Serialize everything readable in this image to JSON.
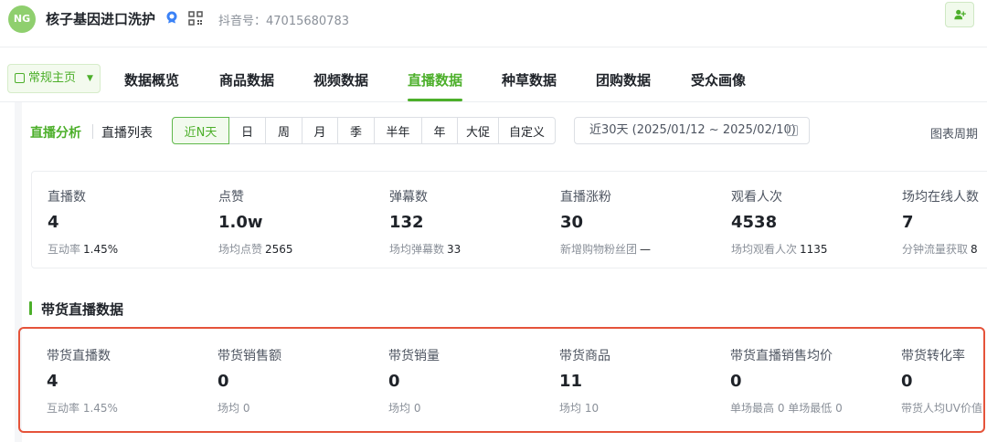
{
  "header": {
    "logo_text": "NG",
    "shop_name": "核子基因进口洗护",
    "douyin_id_label": "抖音号：",
    "douyin_id": "47015680783",
    "icons": [
      "verified-badge-icon",
      "qr-code-icon",
      "add-user-icon"
    ]
  },
  "nav": {
    "home_label": "常规主页",
    "tabs": [
      "数据概览",
      "商品数据",
      "视频数据",
      "直播数据",
      "种草数据",
      "团购数据",
      "受众画像"
    ],
    "active_tab": "直播数据"
  },
  "subnav": {
    "tabs": [
      "直播分析",
      "直播列表"
    ],
    "active": "直播分析",
    "periods": [
      "近N天",
      "日",
      "周",
      "月",
      "季",
      "半年",
      "年",
      "大促",
      "自定义"
    ],
    "active_period": "近N天",
    "date_range": "近30天 (2025/01/12 ~ 2025/02/10)",
    "chart_cycle_label": "图表周期"
  },
  "live_stats": [
    {
      "label": "直播数",
      "value": "4",
      "sub_label": "互动率",
      "sub_value": "1.45%"
    },
    {
      "label": "点赞",
      "value": "1.0w",
      "sub_label": "场均点赞",
      "sub_value": "2565"
    },
    {
      "label": "弹幕数",
      "value": "132",
      "sub_label": "场均弹幕数",
      "sub_value": "33"
    },
    {
      "label": "直播涨粉",
      "value": "30",
      "sub_label": "新增购物粉丝团",
      "sub_value": "—"
    },
    {
      "label": "观看人次",
      "value": "4538",
      "sub_label": "场均观看人次",
      "sub_value": "1135"
    },
    {
      "label": "场均在线人数",
      "value": "7",
      "sub_label": "分钟流量获取",
      "sub_value": "8"
    }
  ],
  "sales_section": {
    "title": "带货直播数据",
    "stats": [
      {
        "label": "带货直播数",
        "value": "4",
        "sub": "互动率 1.45%"
      },
      {
        "label": "带货销售额",
        "value": "0",
        "sub": "场均 0"
      },
      {
        "label": "带货销量",
        "value": "0",
        "sub": "场均 0"
      },
      {
        "label": "带货商品",
        "value": "11",
        "sub": "场均 10"
      },
      {
        "label": "带货直播销售均价",
        "value": "0",
        "sub": "单场最高 0 单场最低 0"
      },
      {
        "label": "带货转化率",
        "value": "0",
        "sub": "带货人均UV价值"
      }
    ]
  },
  "colors": {
    "accent": "#4caf2a",
    "highlight": "#e5533a"
  }
}
